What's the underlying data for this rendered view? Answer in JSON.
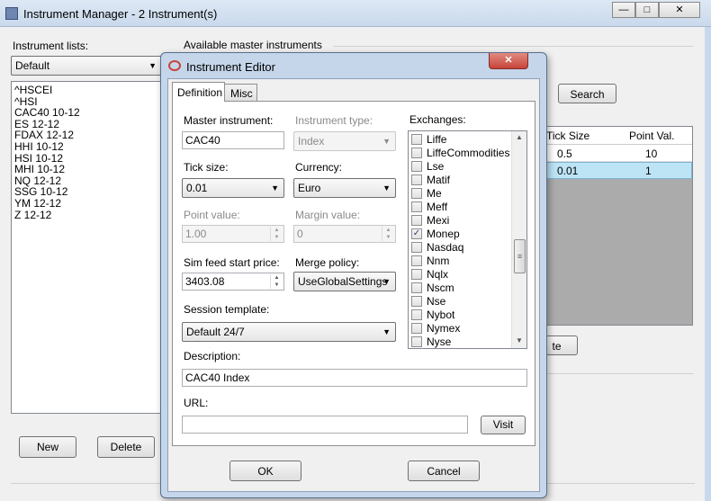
{
  "main_window": {
    "title": "Instrument Manager - 2 Instrument(s)",
    "instrument_lists_label": "Instrument lists:",
    "list_selected": "Default",
    "instruments": [
      "^HSCEI",
      "^HSI",
      "CAC40 10-12",
      "ES 12-12",
      "FDAX 12-12",
      "HHI 10-12",
      "HSI 10-12",
      "MHI 10-12",
      "NQ 12-12",
      "SSG 10-12",
      "YM 12-12",
      "Z 12-12"
    ],
    "new_label": "New",
    "delete_label": "Delete",
    "available_label": "Available master instruments",
    "search_label": "Search",
    "col_tick_size": "Tick Size",
    "col_point_val": "Point Val.",
    "rows": [
      {
        "tick_size": "0.5",
        "point_val": "10"
      },
      {
        "tick_size": "0.01",
        "point_val": "1"
      }
    ],
    "partial_button_label": "te",
    "selection_color": "#bde4f5"
  },
  "editor": {
    "title": "Instrument Editor",
    "tabs": [
      "Definition",
      "Misc"
    ],
    "master_instrument_label": "Master instrument:",
    "master_instrument_value": "CAC40",
    "instrument_type_label": "Instrument type:",
    "instrument_type_value": "Index",
    "tick_size_label": "Tick size:",
    "tick_size_value": "0.01",
    "currency_label": "Currency:",
    "currency_value": "Euro",
    "point_value_label": "Point value:",
    "point_value_value": "1.00",
    "margin_value_label": "Margin value:",
    "margin_value_value": "0",
    "sim_feed_label": "Sim feed start price:",
    "sim_feed_value": "3403.08",
    "merge_policy_label": "Merge policy:",
    "merge_policy_value": "UseGlobalSettings",
    "session_template_label": "Session template:",
    "session_template_value": "Default 24/7",
    "exchanges_label": "Exchanges:",
    "exchanges": [
      {
        "name": "Liffe",
        "checked": false
      },
      {
        "name": "LiffeCommodities",
        "checked": false
      },
      {
        "name": "Lse",
        "checked": false
      },
      {
        "name": "Matif",
        "checked": false
      },
      {
        "name": "Me",
        "checked": false
      },
      {
        "name": "Meff",
        "checked": false
      },
      {
        "name": "Mexi",
        "checked": false
      },
      {
        "name": "Monep",
        "checked": true
      },
      {
        "name": "Nasdaq",
        "checked": false
      },
      {
        "name": "Nnm",
        "checked": false
      },
      {
        "name": "Nqlx",
        "checked": false
      },
      {
        "name": "Nscm",
        "checked": false
      },
      {
        "name": "Nse",
        "checked": false
      },
      {
        "name": "Nybot",
        "checked": false
      },
      {
        "name": "Nymex",
        "checked": false
      },
      {
        "name": "Nyse",
        "checked": false
      }
    ],
    "description_label": "Description:",
    "description_value": "CAC40 Index",
    "url_label": "URL:",
    "url_value": "",
    "visit_label": "Visit",
    "ok_label": "OK",
    "cancel_label": "Cancel",
    "close_color": "#c7443a"
  }
}
